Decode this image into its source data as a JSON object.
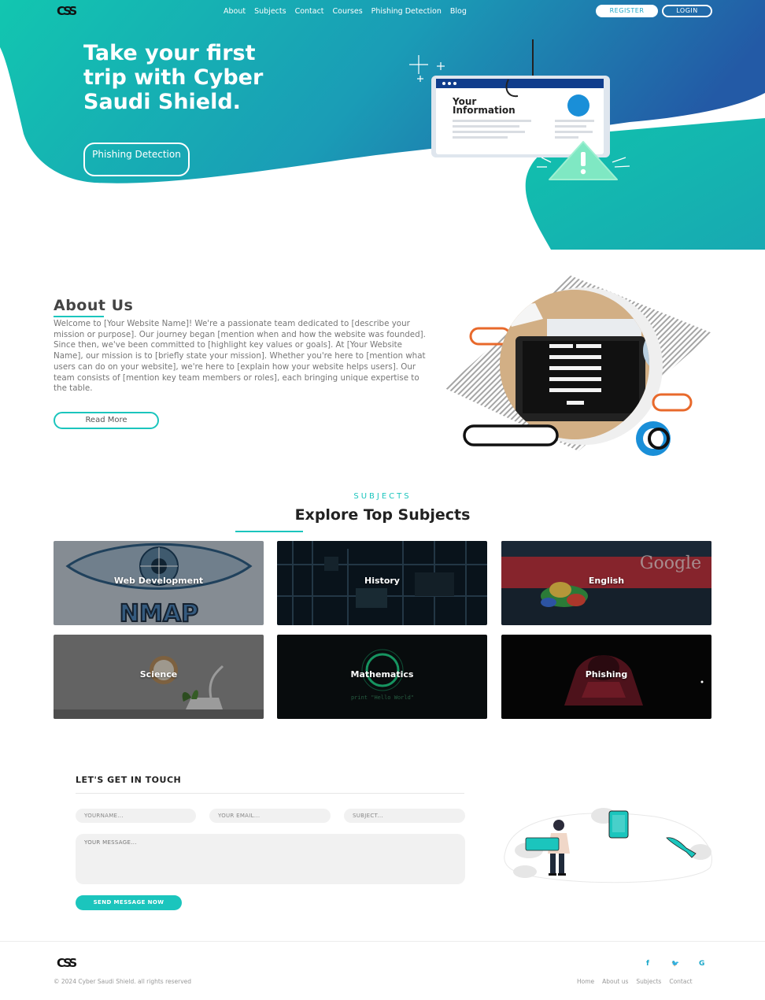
{
  "brand": {
    "logo_text": "CSS"
  },
  "nav": {
    "items": [
      {
        "label": "About"
      },
      {
        "label": "Subjects"
      },
      {
        "label": "Contact"
      },
      {
        "label": "Courses"
      },
      {
        "label": "Phishing Detection"
      },
      {
        "label": "Blog"
      }
    ],
    "register_label": "REGISTER",
    "login_label": "LOGIN"
  },
  "hero": {
    "title": "Take your first trip with Cyber Saudi Shield.",
    "button_label": "Phishing Detection",
    "illustration_text": "Your Information"
  },
  "about": {
    "title": "About Us",
    "text": "Welcome to [Your Website Name]! We're a passionate team dedicated to [describe your mission or purpose]. Our journey began [mention when and how the website was founded]. Since then, we've been committed to [highlight key values or goals]. At [Your Website Name], our mission is to [briefly state your mission]. Whether you're here to [mention what users can do on your website], we're here to [explain how your website helps users]. Our team consists of [mention key team members or roles], each bringing unique expertise to the table.",
    "button_label": "Read More"
  },
  "subjects": {
    "kicker": "SUBJECTS",
    "title": "Explore Top Subjects",
    "cards": [
      {
        "label": "Web Development",
        "image_text": "NMAP"
      },
      {
        "label": "History"
      },
      {
        "label": "English",
        "image_text": "Google"
      },
      {
        "label": "Science"
      },
      {
        "label": "Mathematics",
        "image_text": "print \"Hello World\""
      },
      {
        "label": "Phishing"
      }
    ]
  },
  "contact": {
    "title": "LET'S GET IN TOUCH",
    "name_placeholder": "YOURNAME...",
    "email_placeholder": "YOUR EMAIL...",
    "subject_placeholder": "SUBJECT...",
    "message_placeholder": "YOUR MESSAGE...",
    "send_label": "SEND MESSAGE NOW"
  },
  "footer": {
    "copyright": "© 2024 Cyber Saudi Shield. all rights reserved",
    "social": [
      {
        "icon": "facebook-icon",
        "glyph": "f"
      },
      {
        "icon": "twitter-icon",
        "glyph": "🐦"
      },
      {
        "icon": "google-icon",
        "glyph": "G"
      }
    ],
    "links": [
      {
        "label": "Home"
      },
      {
        "label": "About us"
      },
      {
        "label": "Subjects"
      },
      {
        "label": "Contact"
      }
    ]
  },
  "colors": {
    "teal": "#1bc5bd",
    "blue": "#1f5fa8",
    "accent_orange": "#e8692b"
  }
}
